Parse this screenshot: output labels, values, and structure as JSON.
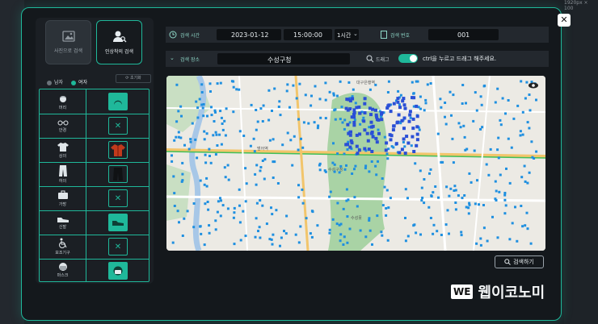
{
  "background": {
    "resolution_badge": "1920px × 100"
  },
  "modes": [
    {
      "label": "사진으로 검색",
      "active": false
    },
    {
      "label": "인상착의 검색",
      "active": true
    }
  ],
  "gender": {
    "male": "남자",
    "female": "여자"
  },
  "reset_label": "초기화",
  "attributes": [
    {
      "name": "머리",
      "icon": "hair-icon",
      "value": "green-hair-icon",
      "filled": true
    },
    {
      "name": "안경",
      "icon": "glasses-icon",
      "value": "none",
      "filled": false
    },
    {
      "name": "상의",
      "icon": "shirt-icon",
      "value": "red-jacket-icon",
      "filled": false
    },
    {
      "name": "하의",
      "icon": "pants-icon",
      "value": "black-pants-icon",
      "filled": false
    },
    {
      "name": "가방",
      "icon": "bag-icon",
      "value": "none",
      "filled": false
    },
    {
      "name": "신발",
      "icon": "shoe-icon",
      "value": "green-shoe-icon",
      "filled": true
    },
    {
      "name": "보조기구",
      "icon": "wheelchair-icon",
      "value": "none",
      "filled": false
    },
    {
      "name": "마스크",
      "icon": "mask-icon",
      "value": "green-mask-icon",
      "filled": true
    }
  ],
  "filters": {
    "time_label": "검색 시간",
    "date": "2023-01-12",
    "time": "15:00:00",
    "range": "1시간",
    "id_label": "검색 번호",
    "id_value": "001",
    "place_label": "검색 장소",
    "place_value": "수성구청",
    "drag_label": "드래그",
    "drag_hint": "ctrl을 누르고 드래그 해주세요."
  },
  "map": {
    "place_labels": [
      "수성구청",
      "대구은행역",
      "범어역",
      "수성못"
    ]
  },
  "search_button": "검색하기",
  "watermark": {
    "box": "WE",
    "text": "웹이코노미"
  },
  "colors": {
    "accent": "#1fb89a",
    "dot": "#1e74d9",
    "dark": "#14181c"
  }
}
